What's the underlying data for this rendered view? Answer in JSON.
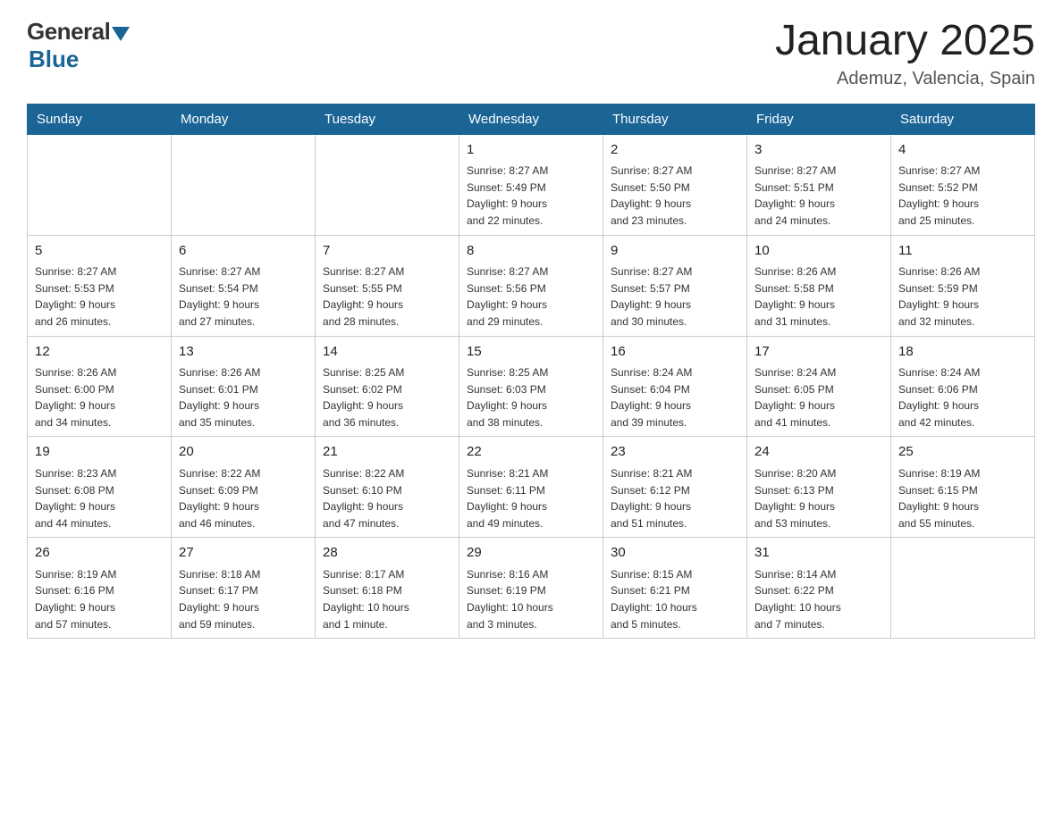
{
  "logo": {
    "general": "General",
    "blue": "Blue",
    "subtitle": "Blue"
  },
  "header": {
    "title": "January 2025",
    "subtitle": "Ademuz, Valencia, Spain"
  },
  "days_of_week": [
    "Sunday",
    "Monday",
    "Tuesday",
    "Wednesday",
    "Thursday",
    "Friday",
    "Saturday"
  ],
  "weeks": [
    [
      {
        "day": "",
        "info": ""
      },
      {
        "day": "",
        "info": ""
      },
      {
        "day": "",
        "info": ""
      },
      {
        "day": "1",
        "info": "Sunrise: 8:27 AM\nSunset: 5:49 PM\nDaylight: 9 hours\nand 22 minutes."
      },
      {
        "day": "2",
        "info": "Sunrise: 8:27 AM\nSunset: 5:50 PM\nDaylight: 9 hours\nand 23 minutes."
      },
      {
        "day": "3",
        "info": "Sunrise: 8:27 AM\nSunset: 5:51 PM\nDaylight: 9 hours\nand 24 minutes."
      },
      {
        "day": "4",
        "info": "Sunrise: 8:27 AM\nSunset: 5:52 PM\nDaylight: 9 hours\nand 25 minutes."
      }
    ],
    [
      {
        "day": "5",
        "info": "Sunrise: 8:27 AM\nSunset: 5:53 PM\nDaylight: 9 hours\nand 26 minutes."
      },
      {
        "day": "6",
        "info": "Sunrise: 8:27 AM\nSunset: 5:54 PM\nDaylight: 9 hours\nand 27 minutes."
      },
      {
        "day": "7",
        "info": "Sunrise: 8:27 AM\nSunset: 5:55 PM\nDaylight: 9 hours\nand 28 minutes."
      },
      {
        "day": "8",
        "info": "Sunrise: 8:27 AM\nSunset: 5:56 PM\nDaylight: 9 hours\nand 29 minutes."
      },
      {
        "day": "9",
        "info": "Sunrise: 8:27 AM\nSunset: 5:57 PM\nDaylight: 9 hours\nand 30 minutes."
      },
      {
        "day": "10",
        "info": "Sunrise: 8:26 AM\nSunset: 5:58 PM\nDaylight: 9 hours\nand 31 minutes."
      },
      {
        "day": "11",
        "info": "Sunrise: 8:26 AM\nSunset: 5:59 PM\nDaylight: 9 hours\nand 32 minutes."
      }
    ],
    [
      {
        "day": "12",
        "info": "Sunrise: 8:26 AM\nSunset: 6:00 PM\nDaylight: 9 hours\nand 34 minutes."
      },
      {
        "day": "13",
        "info": "Sunrise: 8:26 AM\nSunset: 6:01 PM\nDaylight: 9 hours\nand 35 minutes."
      },
      {
        "day": "14",
        "info": "Sunrise: 8:25 AM\nSunset: 6:02 PM\nDaylight: 9 hours\nand 36 minutes."
      },
      {
        "day": "15",
        "info": "Sunrise: 8:25 AM\nSunset: 6:03 PM\nDaylight: 9 hours\nand 38 minutes."
      },
      {
        "day": "16",
        "info": "Sunrise: 8:24 AM\nSunset: 6:04 PM\nDaylight: 9 hours\nand 39 minutes."
      },
      {
        "day": "17",
        "info": "Sunrise: 8:24 AM\nSunset: 6:05 PM\nDaylight: 9 hours\nand 41 minutes."
      },
      {
        "day": "18",
        "info": "Sunrise: 8:24 AM\nSunset: 6:06 PM\nDaylight: 9 hours\nand 42 minutes."
      }
    ],
    [
      {
        "day": "19",
        "info": "Sunrise: 8:23 AM\nSunset: 6:08 PM\nDaylight: 9 hours\nand 44 minutes."
      },
      {
        "day": "20",
        "info": "Sunrise: 8:22 AM\nSunset: 6:09 PM\nDaylight: 9 hours\nand 46 minutes."
      },
      {
        "day": "21",
        "info": "Sunrise: 8:22 AM\nSunset: 6:10 PM\nDaylight: 9 hours\nand 47 minutes."
      },
      {
        "day": "22",
        "info": "Sunrise: 8:21 AM\nSunset: 6:11 PM\nDaylight: 9 hours\nand 49 minutes."
      },
      {
        "day": "23",
        "info": "Sunrise: 8:21 AM\nSunset: 6:12 PM\nDaylight: 9 hours\nand 51 minutes."
      },
      {
        "day": "24",
        "info": "Sunrise: 8:20 AM\nSunset: 6:13 PM\nDaylight: 9 hours\nand 53 minutes."
      },
      {
        "day": "25",
        "info": "Sunrise: 8:19 AM\nSunset: 6:15 PM\nDaylight: 9 hours\nand 55 minutes."
      }
    ],
    [
      {
        "day": "26",
        "info": "Sunrise: 8:19 AM\nSunset: 6:16 PM\nDaylight: 9 hours\nand 57 minutes."
      },
      {
        "day": "27",
        "info": "Sunrise: 8:18 AM\nSunset: 6:17 PM\nDaylight: 9 hours\nand 59 minutes."
      },
      {
        "day": "28",
        "info": "Sunrise: 8:17 AM\nSunset: 6:18 PM\nDaylight: 10 hours\nand 1 minute."
      },
      {
        "day": "29",
        "info": "Sunrise: 8:16 AM\nSunset: 6:19 PM\nDaylight: 10 hours\nand 3 minutes."
      },
      {
        "day": "30",
        "info": "Sunrise: 8:15 AM\nSunset: 6:21 PM\nDaylight: 10 hours\nand 5 minutes."
      },
      {
        "day": "31",
        "info": "Sunrise: 8:14 AM\nSunset: 6:22 PM\nDaylight: 10 hours\nand 7 minutes."
      },
      {
        "day": "",
        "info": ""
      }
    ]
  ]
}
